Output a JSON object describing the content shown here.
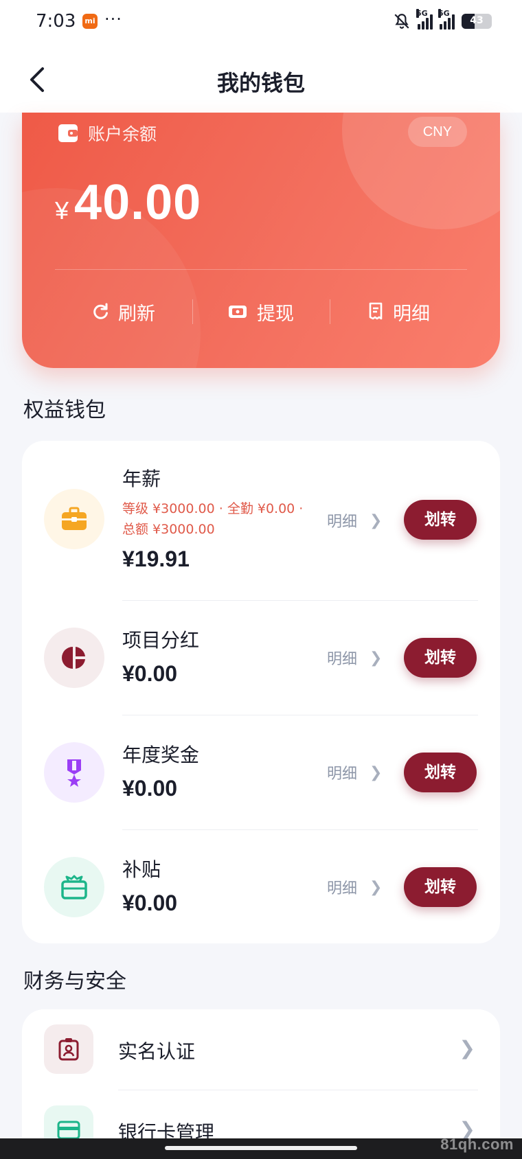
{
  "status_bar": {
    "time": "7:03",
    "dots": "···",
    "network_1": "5G",
    "network_2": "5G",
    "battery": "43",
    "battery_level": 0.43,
    "app_icon": "mi-icon"
  },
  "header": {
    "title": "我的钱包",
    "back_icon": "back-arrow-icon"
  },
  "balance_card": {
    "label": "账户余额",
    "currency": "CNY",
    "currency_symbol": "¥",
    "amount": "40.00",
    "actions": [
      {
        "label": "刷新",
        "icon": "refresh-icon"
      },
      {
        "label": "提现",
        "icon": "withdraw-icon"
      },
      {
        "label": "明细",
        "icon": "receipt-icon"
      }
    ],
    "colors": {
      "start": "#ef5a47",
      "end": "#fa7e6c"
    }
  },
  "rights_section": {
    "title": "权益钱包",
    "detail_label": "明细",
    "transfer_label": "划转",
    "wallets": [
      {
        "name": "年薪",
        "note_line1": "等级 ¥3000.00 · 全勤 ¥0.00 ·",
        "note_line2": "总额 ¥3000.00",
        "amount": "¥19.91",
        "icon": "briefcase-icon",
        "icon_color": "#f5a623",
        "icon_bg": "#fff6e6"
      },
      {
        "name": "项目分红",
        "amount": "¥0.00",
        "icon": "pie-chart-icon",
        "icon_color": "#8c1c30",
        "icon_bg": "#f5eced"
      },
      {
        "name": "年度奖金",
        "amount": "¥0.00",
        "icon": "medal-icon",
        "icon_color": "#9b3ef5",
        "icon_bg": "#f4ecff"
      },
      {
        "name": "补贴",
        "amount": "¥0.00",
        "icon": "gift-card-icon",
        "icon_color": "#1db58a",
        "icon_bg": "#e8f8f2"
      }
    ]
  },
  "finance_section": {
    "title": "财务与安全",
    "items": [
      {
        "label": "实名认证",
        "icon": "id-badge-icon",
        "icon_color": "#8c1c30",
        "icon_bg": "#f5eced"
      },
      {
        "label": "银行卡管理",
        "icon": "bank-card-icon",
        "icon_color": "#1db58a",
        "icon_bg": "#e8f8f2"
      }
    ]
  },
  "watermark": "81qh.com",
  "accent_color": "#8c1c30"
}
